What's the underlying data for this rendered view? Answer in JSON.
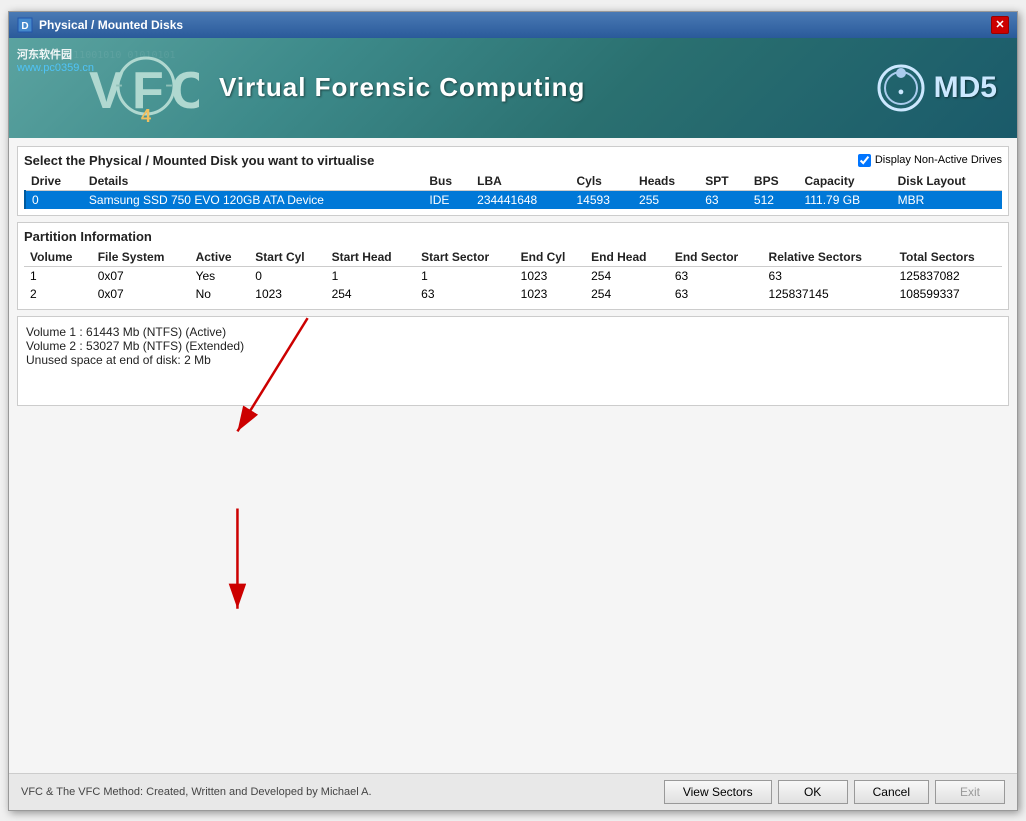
{
  "window": {
    "title": "Physical / Mounted Disks",
    "close_label": "✕"
  },
  "header": {
    "vfc_text": "V-F-C",
    "vfc_num": "4",
    "app_title": "Virtual Forensic Computing",
    "md5_label": "MD5",
    "watermark_line1": "河东软件园",
    "watermark_line2": "www.pc0359.cn"
  },
  "disk_section": {
    "title": "Select the Physical / Mounted Disk you want to virtualise",
    "display_non_active": "Display Non-Active Drives",
    "columns": [
      "Drive",
      "Details",
      "Bus",
      "LBA",
      "Cyls",
      "Heads",
      "SPT",
      "BPS",
      "Capacity",
      "Disk Layout"
    ],
    "rows": [
      {
        "drive": "0",
        "details": "Samsung SSD 750 EVO 120GB ATA Device",
        "bus": "IDE",
        "lba": "234441648",
        "cyls": "14593",
        "heads": "255",
        "spt": "63",
        "bps": "512",
        "capacity": "111.79 GB",
        "disk_layout": "MBR",
        "selected": true
      }
    ]
  },
  "partition_section": {
    "title": "Partition Information",
    "columns": [
      "Volume",
      "File System",
      "Active",
      "Start Cyl",
      "Start Head",
      "Start Sector",
      "End Cyl",
      "End Head",
      "End Sector",
      "Relative Sectors",
      "Total Sectors"
    ],
    "rows": [
      {
        "volume": "1",
        "file_system": "0x07",
        "active": "Yes",
        "start_cyl": "0",
        "start_head": "1",
        "start_sector": "1",
        "end_cyl": "1023",
        "end_head": "254",
        "end_sector": "63",
        "relative_sectors": "63",
        "total_sectors": "125837082"
      },
      {
        "volume": "2",
        "file_system": "0x07",
        "active": "No",
        "start_cyl": "1023",
        "start_head": "254",
        "start_sector": "63",
        "end_cyl": "1023",
        "end_head": "254",
        "end_sector": "63",
        "relative_sectors": "125837145",
        "total_sectors": "108599337"
      }
    ]
  },
  "info_section": {
    "lines": [
      "Volume 1 : 61443 Mb (NTFS) (Active)",
      "Volume 2 : 53027 Mb (NTFS) (Extended)",
      "Unused space at end of disk: 2 Mb"
    ]
  },
  "footer": {
    "copyright": "VFC & The VFC Method: Created, Written and Developed by Michael A.",
    "btn_view_sectors": "View Sectors",
    "btn_ok": "OK",
    "btn_cancel": "Cancel",
    "btn_exit": "Exit"
  }
}
